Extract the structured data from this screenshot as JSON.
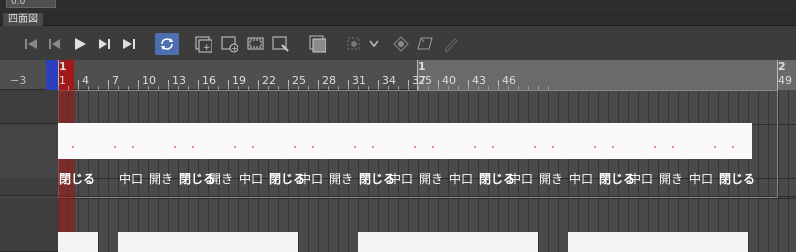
{
  "top": {
    "value": "0.0",
    "tab": "四面図"
  },
  "toolbar": {
    "icons": [
      "go-first-icon",
      "step-back-icon",
      "play-icon",
      "step-forward-icon",
      "go-last-icon",
      "loop-icon",
      "new-animation-folder-icon",
      "new-cel-icon",
      "specify-cel-icon",
      "edit-timeline-icon",
      "onion-skin-icon",
      "camera-work-icon",
      "dropdown-arrow-icon",
      "light-table-icon",
      "add-to-light-table-icon",
      "pen-icon"
    ]
  },
  "ruler": {
    "markers": [
      {
        "marker": "1",
        "sub": "1",
        "circled": true
      },
      {
        "marker": "1",
        "sub": "25"
      },
      {
        "marker": "2",
        "sub": "49"
      }
    ],
    "left_label": "−3",
    "frames": [
      "4",
      "7",
      "10",
      "13",
      "16",
      "19",
      "22",
      "25",
      "28",
      "31",
      "34",
      "37",
      "40",
      "43",
      "46"
    ]
  },
  "timeline": {
    "labels": [
      {
        "text": "閉じる",
        "bold": true
      },
      {
        "text": "中口",
        "bold": false
      },
      {
        "text": "開き",
        "bold": false
      },
      {
        "text": "閉じる",
        "bold": true
      },
      {
        "text": "開き",
        "bold": false
      },
      {
        "text": "中口",
        "bold": false
      },
      {
        "text": "閉じる",
        "bold": true
      },
      {
        "text": "中口",
        "bold": false
      },
      {
        "text": "開き",
        "bold": false
      },
      {
        "text": "閉じる",
        "bold": true
      },
      {
        "text": "中口",
        "bold": false
      },
      {
        "text": "開き",
        "bold": false
      },
      {
        "text": "中口",
        "bold": false
      },
      {
        "text": "閉じる",
        "bold": true
      },
      {
        "text": "中口",
        "bold": false
      },
      {
        "text": "開き",
        "bold": false
      },
      {
        "text": "中口",
        "bold": false
      },
      {
        "text": "閉じる",
        "bold": true
      },
      {
        "text": "中口",
        "bold": false
      },
      {
        "text": "開き",
        "bold": false
      },
      {
        "text": "中口",
        "bold": false
      },
      {
        "text": "閉じる",
        "bold": true
      }
    ]
  },
  "colors": {
    "playhead": "#a31818",
    "blue_marker": "#2c3fbf",
    "accent": "#5a8fd0"
  }
}
